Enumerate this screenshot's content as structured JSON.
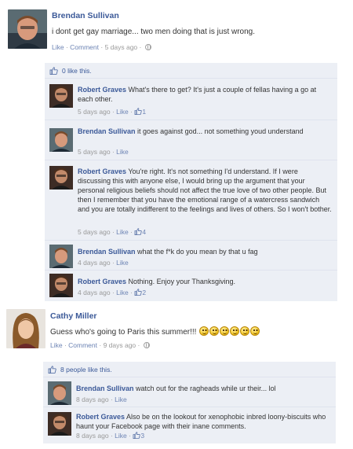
{
  "post1": {
    "author": "Brendan Sullivan",
    "text": "i dont get gay marriage... two men doing that is just wrong.",
    "like": "Like",
    "comment": "Comment",
    "time": "5 days ago",
    "sep": " · ",
    "likes_summary": "0 like this.",
    "comments": [
      {
        "author": "Robert Graves",
        "text": "What's there to get? It's just a couple of fellas having a go at each other.",
        "time": "5 days ago",
        "like": "Like",
        "like_count": "1"
      },
      {
        "author": "Brendan Sullivan",
        "text": "it goes against god... not something youd understand",
        "time": "5 days ago",
        "like": "Like",
        "like_count": ""
      },
      {
        "author": "Robert Graves",
        "text": "You're right. It's not something I'd understand. If I were discussing this with anyone else, I would bring up the argument that your personal religious beliefs should not affect the true love of two other people. But then I remember that you have the emotional range of a watercress sandwich and you are totally indifferent to the feelings and lives of others. So I won't bother.",
        "time": "5 days ago",
        "like": "Like",
        "like_count": "4"
      },
      {
        "author": "Brendan Sullivan",
        "text": "what the f*k do you mean by that u fag",
        "time": "4 days ago",
        "like": "Like",
        "like_count": ""
      },
      {
        "author": "Robert Graves",
        "text": "Nothing. Enjoy your Thanksgiving.",
        "time": "4 days ago",
        "like": "Like",
        "like_count": "2"
      }
    ]
  },
  "post2": {
    "author": "Cathy Miller",
    "text": "Guess who's going to Paris this summer!!!",
    "like": "Like",
    "comment": "Comment",
    "time": "9 days ago",
    "sep": " · ",
    "likes_summary": "8 people like this.",
    "comments": [
      {
        "author": "Brendan Sullivan",
        "text": "watch out for the ragheads while ur their... lol",
        "time": "8 days ago",
        "like": "Like",
        "like_count": ""
      },
      {
        "author": "Robert Graves",
        "text": "Also be on the lookout for xenophobic inbred loony-biscuits who haunt your Facebook page with their inane comments.",
        "time": "8 days ago",
        "like": "Like",
        "like_count": "3"
      }
    ]
  },
  "colors": {
    "link": "#3b5998",
    "meta_link": "#6d84b4",
    "ufi_bg": "#eceff5",
    "meta": "#999999"
  },
  "icons": [
    "thumbs-up-icon",
    "globe-icon",
    "smiley-icon"
  ]
}
